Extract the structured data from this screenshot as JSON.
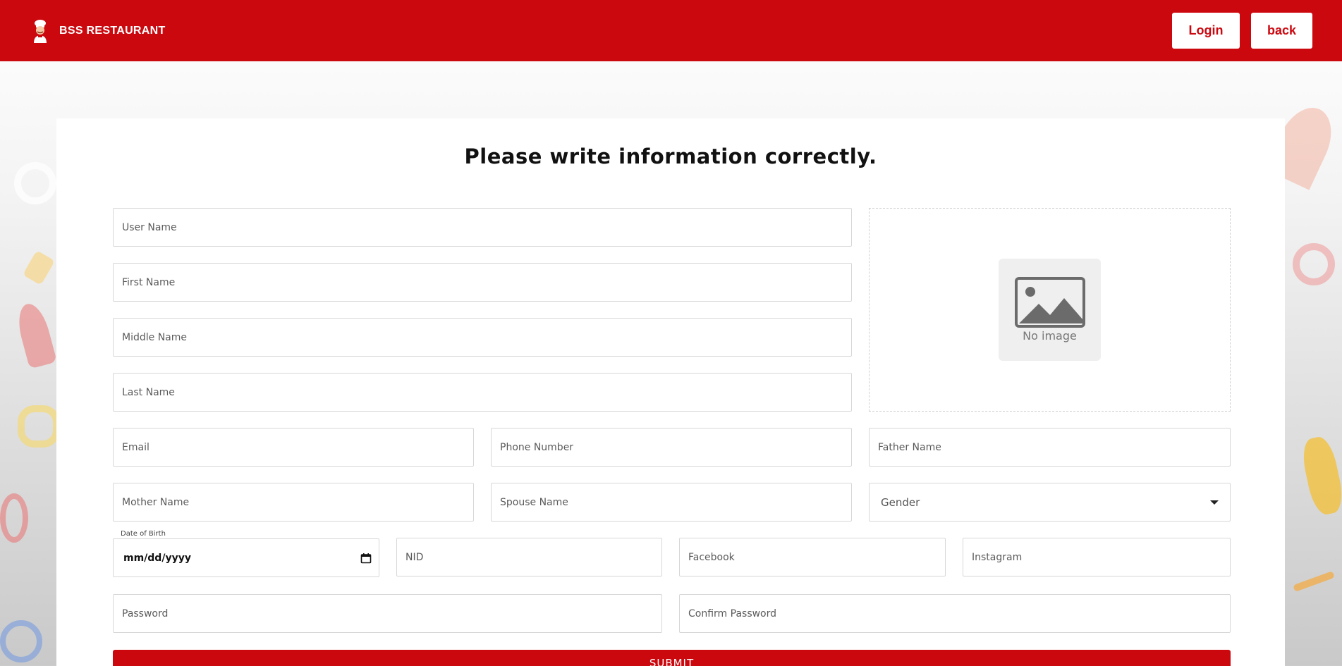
{
  "header": {
    "brand": "BSS RESTAURANT",
    "login_label": "Login",
    "back_label": "back"
  },
  "form": {
    "title": "Please write information correctly.",
    "user_name": "User Name",
    "first_name": "First Name",
    "middle_name": "Middle Name",
    "last_name": "Last Name",
    "email": "Email",
    "phone": "Phone Number",
    "father_name": "Father Name",
    "mother_name": "Mother Name",
    "spouse_name": "Spouse Name",
    "gender": "Gender",
    "dob_label": "Date of Birth",
    "dob_value": "mm/dd/yyyy",
    "nid": "NID",
    "facebook": "Facebook",
    "instagram": "Instagram",
    "password": "Password",
    "confirm_password": "Confirm Password",
    "submit_label": "SUBMIT",
    "no_image_text": "No image"
  },
  "colors": {
    "brand_red": "#cc080f"
  }
}
